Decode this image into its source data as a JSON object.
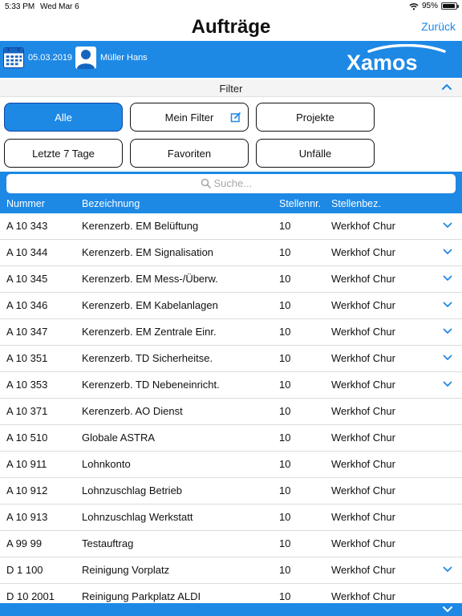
{
  "status_bar": {
    "time": "5:33 PM",
    "date": "Wed Mar 6",
    "battery": "95%",
    "battery_level": 0.95
  },
  "nav": {
    "title": "Aufträge",
    "back_label": "Zurück"
  },
  "header": {
    "date": "05.03.2019",
    "user": "Müller Hans",
    "logo_text": "Xamos"
  },
  "filter": {
    "label": "Filter",
    "buttons": [
      {
        "label": "Alle",
        "active": true
      },
      {
        "label": "Mein Filter",
        "active": false
      },
      {
        "label": "Projekte",
        "active": false
      },
      {
        "label": "Letzte 7 Tage",
        "active": false
      },
      {
        "label": "Favoriten",
        "active": false
      },
      {
        "label": "Unfälle",
        "active": false
      }
    ]
  },
  "search": {
    "placeholder": "Suche..."
  },
  "table": {
    "columns": [
      "Nummer",
      "Bezeichnung",
      "Stellennr.",
      "Stellenbez."
    ],
    "rows": [
      {
        "nummer": "A 10 343",
        "bezeichnung": "Kerenzerb. EM Belüftung",
        "stellennr": "10",
        "stellenbez": "Werkhof Chur",
        "expandable": true
      },
      {
        "nummer": "A 10 344",
        "bezeichnung": "Kerenzerb. EM Signalisation",
        "stellennr": "10",
        "stellenbez": "Werkhof Chur",
        "expandable": true
      },
      {
        "nummer": "A 10 345",
        "bezeichnung": "Kerenzerb. EM Mess-/Überw.",
        "stellennr": "10",
        "stellenbez": "Werkhof Chur",
        "expandable": true
      },
      {
        "nummer": "A 10 346",
        "bezeichnung": "Kerenzerb. EM Kabelanlagen",
        "stellennr": "10",
        "stellenbez": "Werkhof Chur",
        "expandable": true
      },
      {
        "nummer": "A 10 347",
        "bezeichnung": "Kerenzerb. EM Zentrale Einr.",
        "stellennr": "10",
        "stellenbez": "Werkhof Chur",
        "expandable": true
      },
      {
        "nummer": "A 10 351",
        "bezeichnung": "Kerenzerb. TD Sicherheitse.",
        "stellennr": "10",
        "stellenbez": "Werkhof Chur",
        "expandable": true
      },
      {
        "nummer": "A 10 353",
        "bezeichnung": "Kerenzerb. TD Nebeneinricht.",
        "stellennr": "10",
        "stellenbez": "Werkhof Chur",
        "expandable": true
      },
      {
        "nummer": "A 10 371",
        "bezeichnung": "Kerenzerb. AO Dienst",
        "stellennr": "10",
        "stellenbez": "Werkhof Chur",
        "expandable": false
      },
      {
        "nummer": "A 10 510",
        "bezeichnung": "Globale ASTRA",
        "stellennr": "10",
        "stellenbez": "Werkhof Chur",
        "expandable": false
      },
      {
        "nummer": "A 10 911",
        "bezeichnung": "Lohnkonto",
        "stellennr": "10",
        "stellenbez": "Werkhof Chur",
        "expandable": false
      },
      {
        "nummer": "A 10 912",
        "bezeichnung": "Lohnzuschlag Betrieb",
        "stellennr": "10",
        "stellenbez": "Werkhof Chur",
        "expandable": false
      },
      {
        "nummer": "A 10 913",
        "bezeichnung": "Lohnzuschlag Werkstatt",
        "stellennr": "10",
        "stellenbez": "Werkhof Chur",
        "expandable": false
      },
      {
        "nummer": "A 99 99",
        "bezeichnung": "Testauftrag",
        "stellennr": "10",
        "stellenbez": "Werkhof Chur",
        "expandable": false
      },
      {
        "nummer": "D 1 100",
        "bezeichnung": "Reinigung Vorplatz",
        "stellennr": "10",
        "stellenbez": "Werkhof Chur",
        "expandable": true
      },
      {
        "nummer": "D 10 2001",
        "bezeichnung": "Reinigung Parkplatz ALDI",
        "stellennr": "10",
        "stellenbez": "Werkhof Chur",
        "expandable": false
      }
    ]
  },
  "colors": {
    "accent": "#1e88e5",
    "accent_dark": "#0d47a1",
    "row_divider": "#dcdcdc"
  },
  "icons": [
    "wifi-icon",
    "battery-icon",
    "calendar-icon",
    "user-icon",
    "chevron-up-icon",
    "edit-icon",
    "search-icon",
    "chevron-down-icon"
  ]
}
